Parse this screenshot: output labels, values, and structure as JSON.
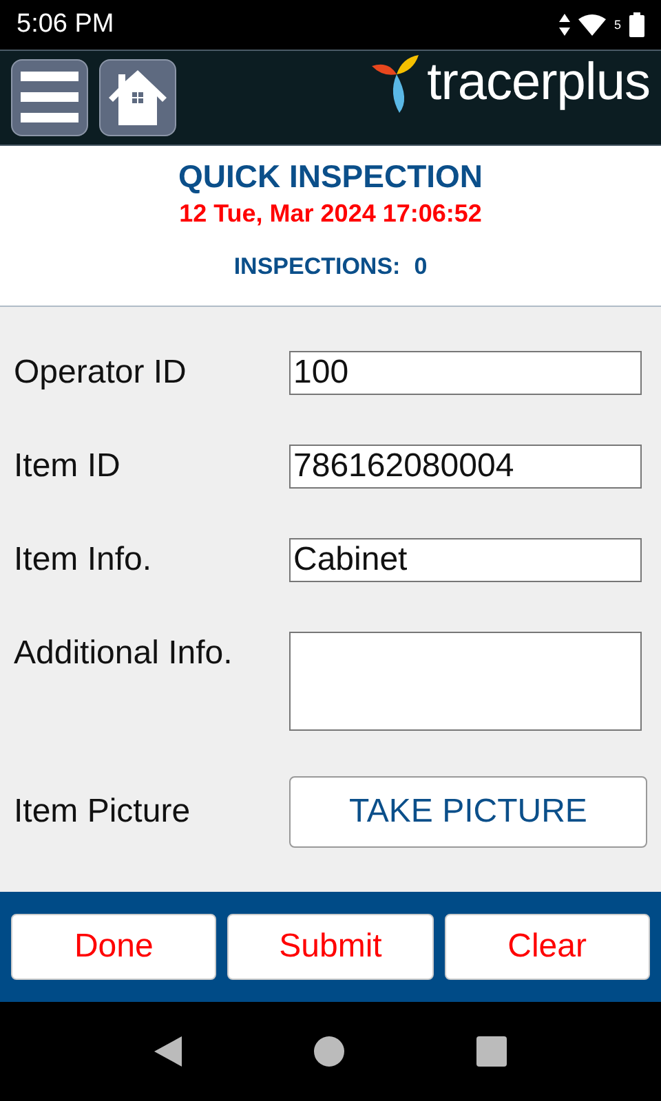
{
  "status_bar": {
    "time": "5:06 PM",
    "wifi_badge": "5"
  },
  "header": {
    "logo_text": "tracerplus"
  },
  "title": "QUICK INSPECTION",
  "datetime": "12 Tue, Mar 2024 17:06:52",
  "counter": {
    "label": "INSPECTIONS:",
    "value": "0"
  },
  "fields": [
    {
      "kind": "input",
      "label": "Operator ID",
      "value": "100"
    },
    {
      "kind": "input",
      "label": "Item ID",
      "value": "786162080004"
    },
    {
      "kind": "input",
      "label": "Item Info.",
      "value": "Cabinet"
    },
    {
      "kind": "textarea",
      "label": "Additional Info."
    },
    {
      "kind": "button",
      "label": "Item Picture",
      "button": "TAKE PICTURE"
    }
  ],
  "actions": [
    "Done",
    "Submit",
    "Clear"
  ]
}
